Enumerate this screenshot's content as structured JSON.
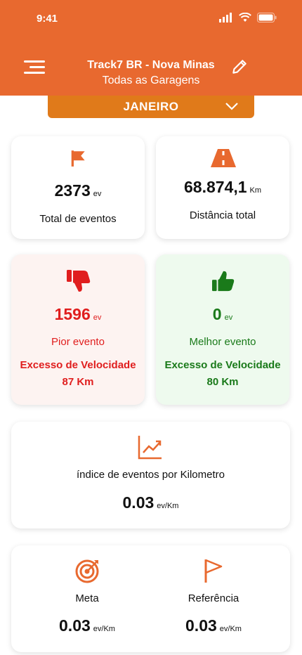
{
  "status": {
    "time": "9:41"
  },
  "header": {
    "title": "Track7 BR - Nova Minas",
    "subtitle": "Todas as Garagens"
  },
  "month": {
    "selected": "JANEIRO"
  },
  "total_events": {
    "value": "2373",
    "unit": "ev",
    "label": "Total de eventos"
  },
  "total_distance": {
    "value": "68.874,1",
    "unit": "Km",
    "label": "Distância total"
  },
  "worst_event": {
    "value": "1596",
    "unit": "ev",
    "label": "Pior evento",
    "type": "Excesso de Velocidade",
    "distance": "87 Km"
  },
  "best_event": {
    "value": "0",
    "unit": "ev",
    "label": "Melhor evento",
    "type": "Excesso de Velocidade",
    "distance": "80 Km"
  },
  "index": {
    "label": "índice de eventos por Kilometro",
    "value": "0.03",
    "unit": "ev/Km"
  },
  "meta": {
    "label": "Meta",
    "value": "0.03",
    "unit": "ev/Km"
  },
  "reference": {
    "label": "Referência",
    "value": "0.03",
    "unit": "ev/Km"
  },
  "colors": {
    "accent": "#e8692f",
    "month_bar": "#e07a1a",
    "bad": "#e01e1e",
    "good": "#1a7a1a"
  }
}
